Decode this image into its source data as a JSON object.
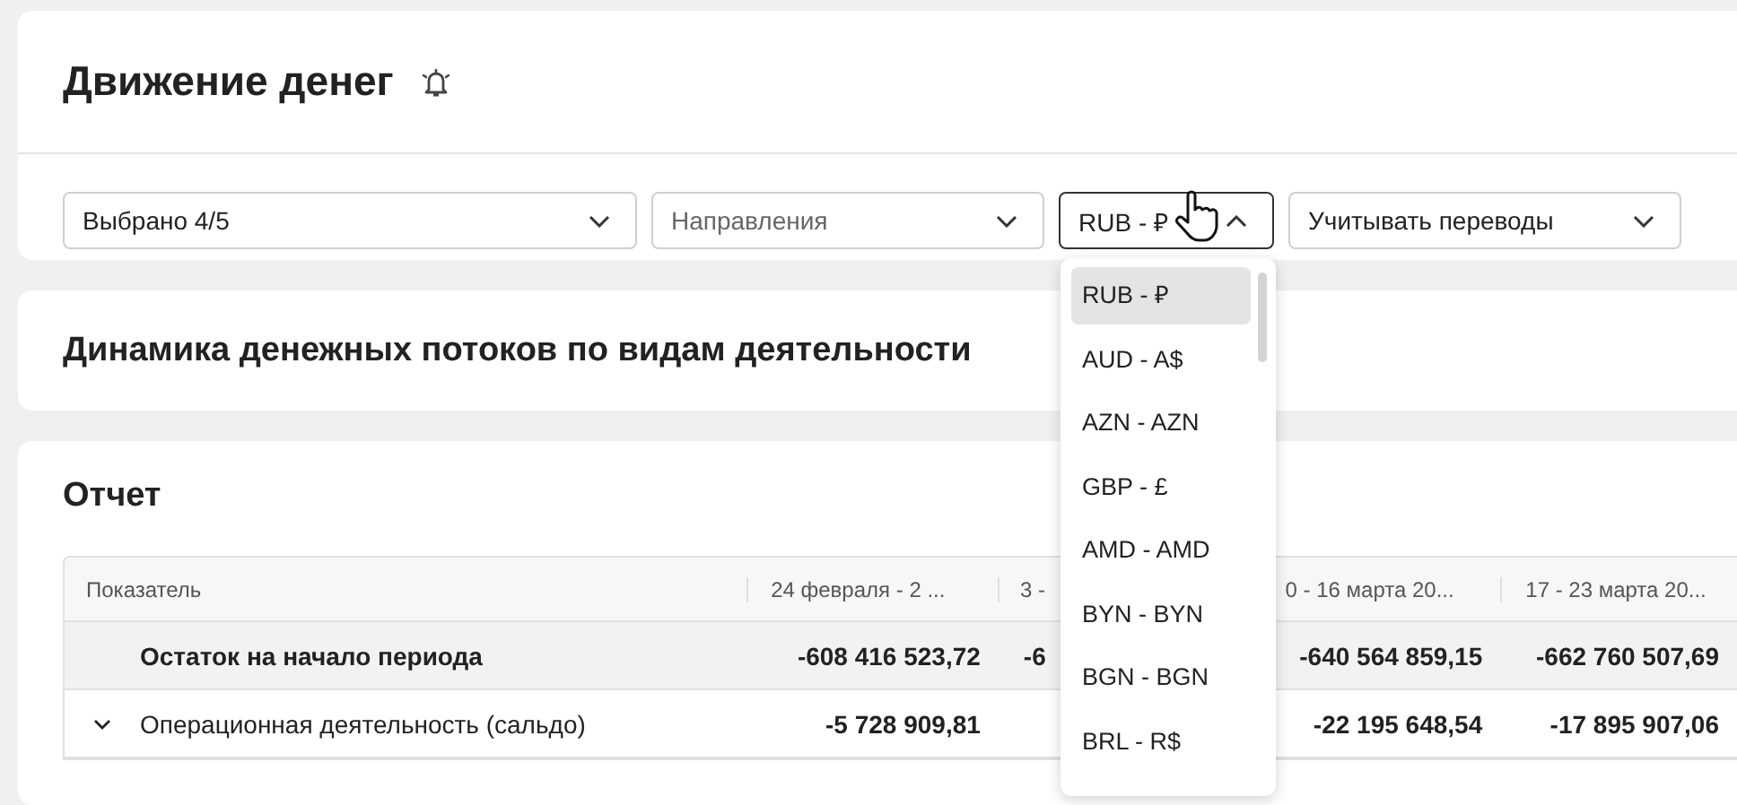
{
  "header": {
    "title": "Движение денег"
  },
  "filters": [
    {
      "kind": "select",
      "value": "Выбрано 4/5",
      "open": false
    },
    {
      "kind": "placeholder",
      "value": "Направления",
      "open": false
    },
    {
      "kind": "select",
      "value": "RUB - ₽",
      "open": true
    },
    {
      "kind": "select",
      "value": "Учитывать переводы",
      "open": false
    }
  ],
  "currency_menu": {
    "items": [
      {
        "label": "RUB - ₽",
        "selected": true
      },
      {
        "label": "AUD - A$",
        "selected": false
      },
      {
        "label": "AZN - AZN",
        "selected": false
      },
      {
        "label": "GBP - £",
        "selected": false
      },
      {
        "label": "AMD - AMD",
        "selected": false
      },
      {
        "label": "BYN - BYN",
        "selected": false
      },
      {
        "label": "BGN - BGN",
        "selected": false
      },
      {
        "label": "BRL - R$",
        "selected": false
      }
    ]
  },
  "chart_section": {
    "title": "Динамика денежных потоков по видам деятельности"
  },
  "report": {
    "title": "Отчет",
    "columns": [
      "Показатель",
      "24 февраля - 2 ...",
      "3 -",
      "0 - 16 марта 20...",
      "17 - 23 марта 20..."
    ],
    "rows": [
      {
        "kind": "total",
        "cells": [
          "Остаток на начало периода",
          "-608 416 523,72",
          "-6",
          "-640 564 859,15",
          "-662 760 507,69"
        ]
      },
      {
        "kind": "group",
        "expanded": true,
        "cells": [
          "Операционная деятельность (сальдо)",
          "-5 728 909,81",
          "",
          "-22 195 648,54",
          "-17 895 907,06"
        ]
      }
    ]
  }
}
